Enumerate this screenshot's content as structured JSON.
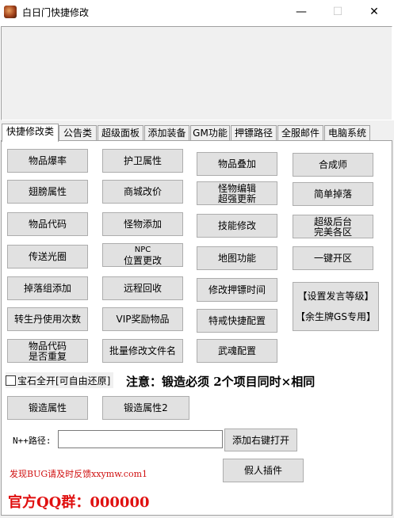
{
  "window": {
    "title": "白日门快捷修改",
    "minimize_glyph": "—",
    "maximize_glyph": "☐",
    "close_glyph": "✕"
  },
  "tabs": [
    "快捷修改类",
    "公告类",
    "超级面板",
    "添加装备",
    "GM功能",
    "押镖路径",
    "全服邮件",
    "电脑系统"
  ],
  "buttons": {
    "item_drop_rate": "物品爆率",
    "guard_attr": "护卫属性",
    "item_stack": "物品叠加",
    "synthesis": "合成师",
    "wings_attr": "翅膀属性",
    "mall_price": "商城改价",
    "monster_edit_l1": "怪物编辑",
    "monster_edit_l2": "超强更新",
    "simple_drop": "简单掉落",
    "item_code": "物品代码",
    "monster_add": "怪物添加",
    "skill_edit": "技能修改",
    "super_backend_l1": "超级后台",
    "super_backend_l2": "完美各区",
    "teleport_circle": "传送光圈",
    "npc_pos_l1": "NPC",
    "npc_pos_l2": "位置更改",
    "map_function": "地图功能",
    "one_key_open": "一键开区",
    "drop_group_add": "掉落组添加",
    "remote_recycle": "远程回收",
    "escort_time": "修改押镖时间",
    "set_speech_level": "【设置发言等级】",
    "yusheng_gs": "【余生牌GS专用】",
    "rebirth_pill": "转生丹使用次数",
    "vip_reward": "VIP奖励物品",
    "ring_shortcut": "特戒快捷配置",
    "item_code_repeat_l1": "物品代码",
    "item_code_repeat_l2": "是否重复",
    "batch_rename": "批量修改文件名",
    "weapon_soul": "武魂配置",
    "forge_attr": "锻造属性",
    "forge_attr2": "锻造属性2",
    "add_right_click": "添加右键打开",
    "fake_plugin": "假人插件"
  },
  "gem_checkbox_label": "宝石全开[可自由还原]",
  "notice": "注意：锻造必须 2个项目同时×相同",
  "path": {
    "label": "N++路径:",
    "value": ""
  },
  "bug_report": "发现BUG请及时反馈xxymw.com1",
  "qq_group": "官方QQ群：000000"
}
